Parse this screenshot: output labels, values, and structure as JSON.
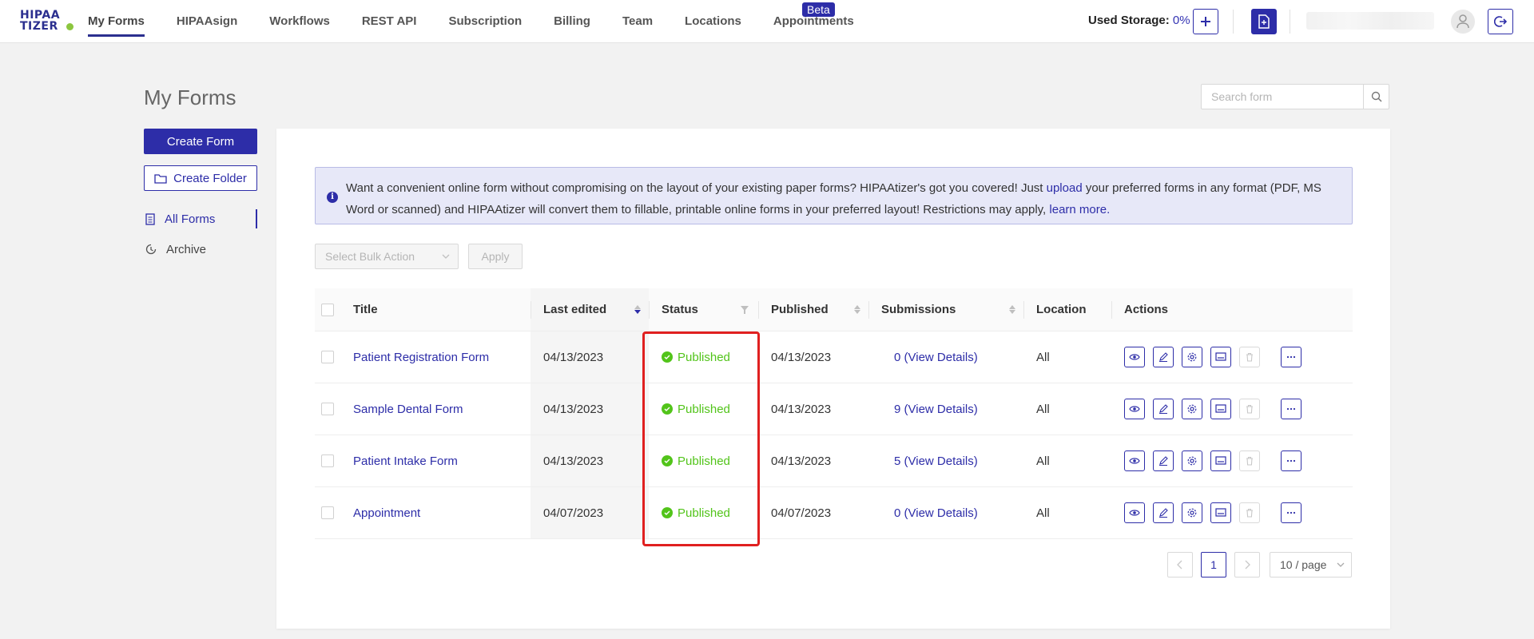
{
  "brand": {
    "logo_line1": "HIPAA",
    "logo_line2": "TIZER"
  },
  "nav": {
    "items": [
      {
        "label": "My Forms",
        "active": true
      },
      {
        "label": "HIPAAsign"
      },
      {
        "label": "Workflows"
      },
      {
        "label": "REST API"
      },
      {
        "label": "Subscription"
      },
      {
        "label": "Billing"
      },
      {
        "label": "Team"
      },
      {
        "label": "Locations"
      },
      {
        "label": "Appointments"
      }
    ],
    "beta_badge": "Beta",
    "storage_label": "Used Storage:",
    "storage_value": "0%"
  },
  "page": {
    "title": "My Forms",
    "search_placeholder": "Search form"
  },
  "sidebar": {
    "create_form": "Create Form",
    "create_folder": "Create Folder",
    "items": [
      {
        "label": "All Forms",
        "icon": "forms-list-icon",
        "active": true
      },
      {
        "label": "Archive",
        "icon": "archive-icon"
      }
    ]
  },
  "notice": {
    "text1": "Want a convenient online form without compromising on the layout of your existing paper forms? HIPAAtizer's got you covered! Just ",
    "link1": "upload",
    "text2": " your preferred forms in any format (PDF, MS Word or scanned) and HIPAAtizer will convert them to fillable, printable online forms in your preferred layout! Restrictions may apply, ",
    "link2": "learn more."
  },
  "bulk": {
    "placeholder": "Select Bulk Action",
    "apply": "Apply"
  },
  "table": {
    "columns": [
      "Title",
      "Last edited",
      "Status",
      "Published",
      "Submissions",
      "Location",
      "Actions"
    ],
    "rows": [
      {
        "title": "Patient Registration Form",
        "last_edited": "04/13/2023",
        "status": "Published",
        "published": "04/13/2023",
        "submissions": "0 (View Details)",
        "location": "All"
      },
      {
        "title": "Sample Dental Form",
        "last_edited": "04/13/2023",
        "status": "Published",
        "published": "04/13/2023",
        "submissions": "9 (View Details)",
        "location": "All"
      },
      {
        "title": "Patient Intake Form",
        "last_edited": "04/13/2023",
        "status": "Published",
        "published": "04/13/2023",
        "submissions": "5 (View Details)",
        "location": "All"
      },
      {
        "title": "Appointment",
        "last_edited": "04/07/2023",
        "status": "Published",
        "published": "04/07/2023",
        "submissions": "0 (View Details)",
        "location": "All"
      }
    ]
  },
  "pagination": {
    "current_page": "1",
    "page_size": "10 / page"
  },
  "colors": {
    "accent": "#2d2da8",
    "success": "#52c41a",
    "highlight": "#e02020"
  }
}
